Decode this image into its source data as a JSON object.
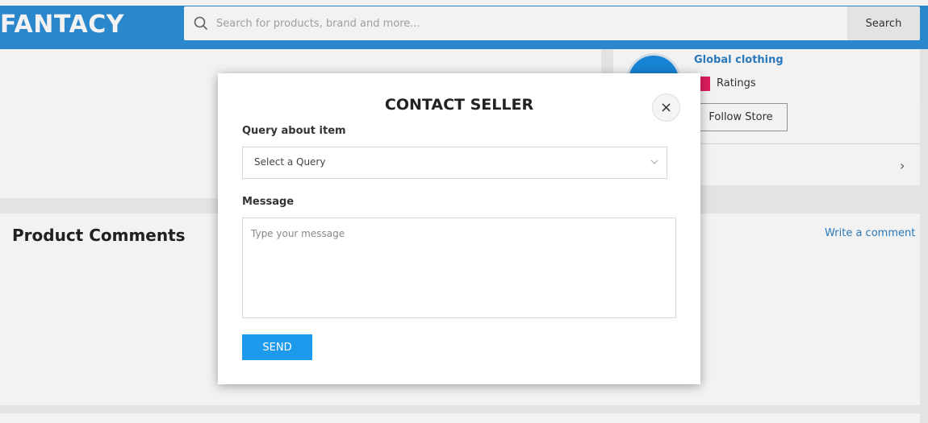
{
  "header": {
    "logo": "FANTACY",
    "search_placeholder": "Search for products, brand and more...",
    "search_button": "Search",
    "brand_color": "#2e8fd6"
  },
  "store": {
    "name": "Global clothing",
    "ratings_label": "Ratings",
    "follow_button": "Follow Store"
  },
  "comments": {
    "title": "Product Comments",
    "write_link": "Write a comment"
  },
  "modal": {
    "title": "CONTACT SELLER",
    "close_glyph": "×",
    "query_label": "Query about item",
    "query_selected": "Select a Query",
    "message_label": "Message",
    "message_placeholder": "Type your message",
    "send_button": "SEND",
    "send_color": "#1e9aec"
  }
}
